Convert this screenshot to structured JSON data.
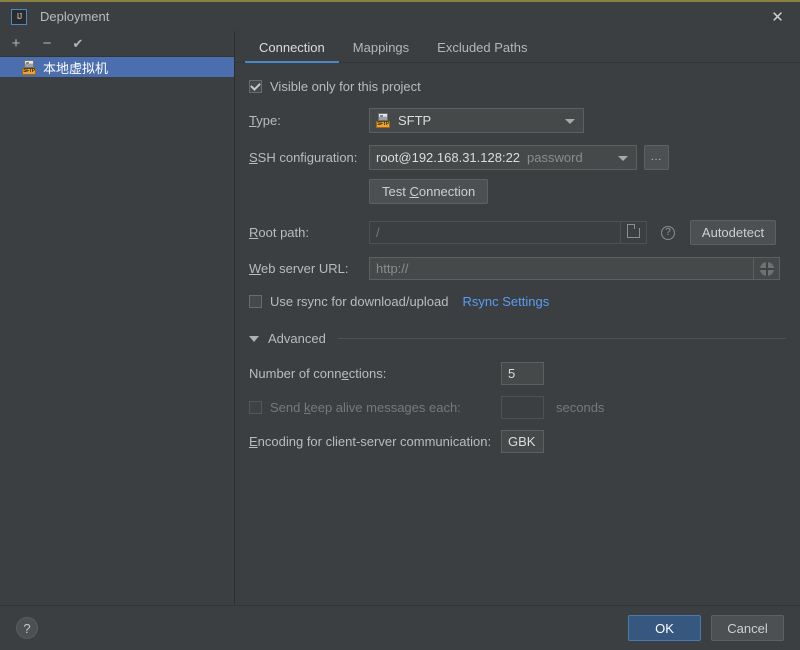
{
  "window": {
    "title": "Deployment",
    "app_icon": "IJ",
    "close_label": "✕"
  },
  "sidebar": {
    "toolbar": [
      {
        "name": "add",
        "glyph": "+"
      },
      {
        "name": "remove",
        "glyph": "−"
      },
      {
        "name": "set-default",
        "glyph": "✔"
      }
    ],
    "items": [
      {
        "label": "本地虚拟机",
        "icon": "sftp-server-icon",
        "tag": "SFTP",
        "selected": true
      }
    ]
  },
  "tabs": [
    {
      "label": "Connection",
      "active": true
    },
    {
      "label": "Mappings",
      "active": false
    },
    {
      "label": "Excluded Paths",
      "active": false
    }
  ],
  "connection": {
    "visible_only": {
      "label": "Visible only for this project",
      "checked": true
    },
    "type": {
      "label": "Type:",
      "value": "SFTP",
      "icon_tag": "SFTP"
    },
    "ssh_configuration": {
      "label": "SSH configuration:",
      "value": "root@192.168.31.128:22",
      "auth": "password",
      "browse_label": "..."
    },
    "test_connection": {
      "label": "Test Connection"
    },
    "root_path": {
      "label": "Root path:",
      "value": "/",
      "folder_icon": "folder-icon",
      "help_icon": "question-mark-icon",
      "autodetect_label": "Autodetect",
      "disabled": true
    },
    "web_server_url": {
      "label": "Web server URL:",
      "value": "http://",
      "globe_icon": "globe-icon"
    },
    "rsync": {
      "label": "Use rsync for download/upload",
      "checked": false,
      "settings_link": "Rsync Settings"
    },
    "advanced": {
      "label": "Advanced",
      "expanded": true,
      "number_of_connections": {
        "label": "Number of connections:",
        "value": "5"
      },
      "keep_alive": {
        "label": "Send keep alive messages each:",
        "value": "",
        "unit": "seconds",
        "checked": false,
        "disabled": true
      },
      "encoding": {
        "label": "Encoding for client-server communication:",
        "value": "GBK"
      }
    }
  },
  "footer": {
    "help_label": "?",
    "ok_label": "OK",
    "cancel_label": "Cancel"
  },
  "colors": {
    "accent_blue": "#4a88c7",
    "selection_blue": "#4b6eaf",
    "link_blue": "#589df6",
    "panel_bg": "#3c3f41",
    "sftp_orange": "#e8a33d",
    "top_border": "#8a8243"
  }
}
